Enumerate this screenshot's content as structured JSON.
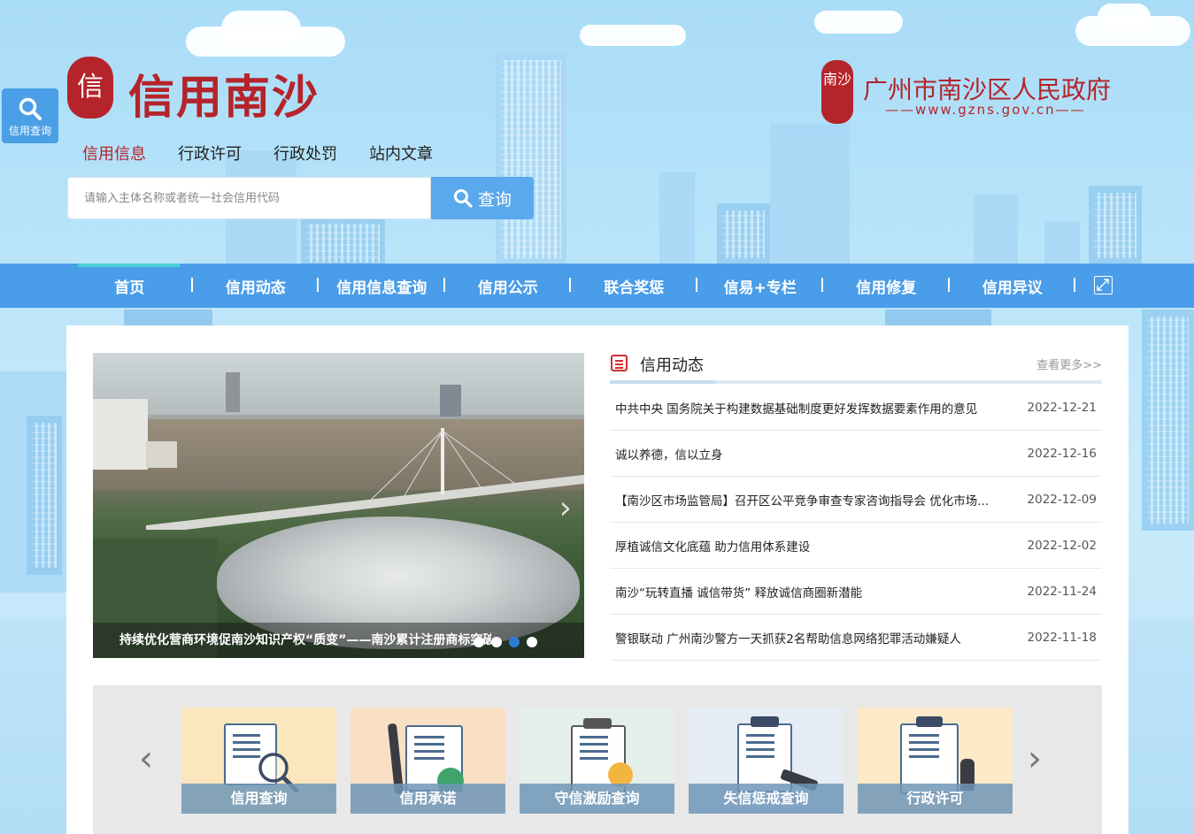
{
  "brand": {
    "seal_char": "信",
    "title": "信用南沙",
    "gov_seal": "南沙",
    "gov_name": "广州市南沙区人民政府",
    "gov_url": "——www.gzns.gov.cn——"
  },
  "side_search": {
    "label": "信用查询",
    "icon": "search-icon"
  },
  "search": {
    "tabs": [
      {
        "label": "信用信息",
        "active": true
      },
      {
        "label": "行政许可",
        "active": false
      },
      {
        "label": "行政处罚",
        "active": false
      },
      {
        "label": "站内文章",
        "active": false
      }
    ],
    "placeholder": "请输入主体名称或者统一社会信用代码",
    "button_label": "查询"
  },
  "nav": {
    "items": [
      "首页",
      "信用动态",
      "信用信息查询",
      "信用公示",
      "联合奖惩",
      "信易+专栏",
      "信用修复",
      "信用异议"
    ],
    "active_index": 0,
    "expand_icon": "fullscreen-icon"
  },
  "carousel": {
    "caption": "持续优化营商环境促南沙知识产权“质变”——南沙累计注册商标突破1...",
    "dot_count": 4,
    "active_dot": 1
  },
  "news": {
    "title": "信用动态",
    "more_label": "查看更多>>",
    "items": [
      {
        "title": "中共中央 国务院关于构建数据基础制度更好发挥数据要素作用的意见",
        "date": "2022-12-21"
      },
      {
        "title": "诚以养德，信以立身",
        "date": "2022-12-16"
      },
      {
        "title": "【南沙区市场监管局】召开区公平竞争审查专家咨询指导会 优化市场...",
        "date": "2022-12-09"
      },
      {
        "title": "厚植诚信文化底蕴 助力信用体系建设",
        "date": "2022-12-02"
      },
      {
        "title": "南沙“玩转直播 诚信带货” 释放诚信商圈新潜能",
        "date": "2022-11-24"
      },
      {
        "title": "警银联动 广州南沙警方一天抓获2名帮助信息网络犯罪活动嫌疑人",
        "date": "2022-11-18"
      }
    ]
  },
  "services": {
    "items": [
      {
        "label": "信用查询",
        "bg": "#fbe6bd"
      },
      {
        "label": "信用承诺",
        "bg": "#f9dfc4"
      },
      {
        "label": "守信激励查询",
        "bg": "#e4efe9"
      },
      {
        "label": "失信惩戒查询",
        "bg": "#e6ecf3"
      },
      {
        "label": "行政许可",
        "bg": "#fbe9c7"
      }
    ]
  },
  "colors": {
    "brand_red": "#b5242b",
    "nav_blue": "#4a9de8",
    "accent_blue": "#5aa9ec"
  }
}
